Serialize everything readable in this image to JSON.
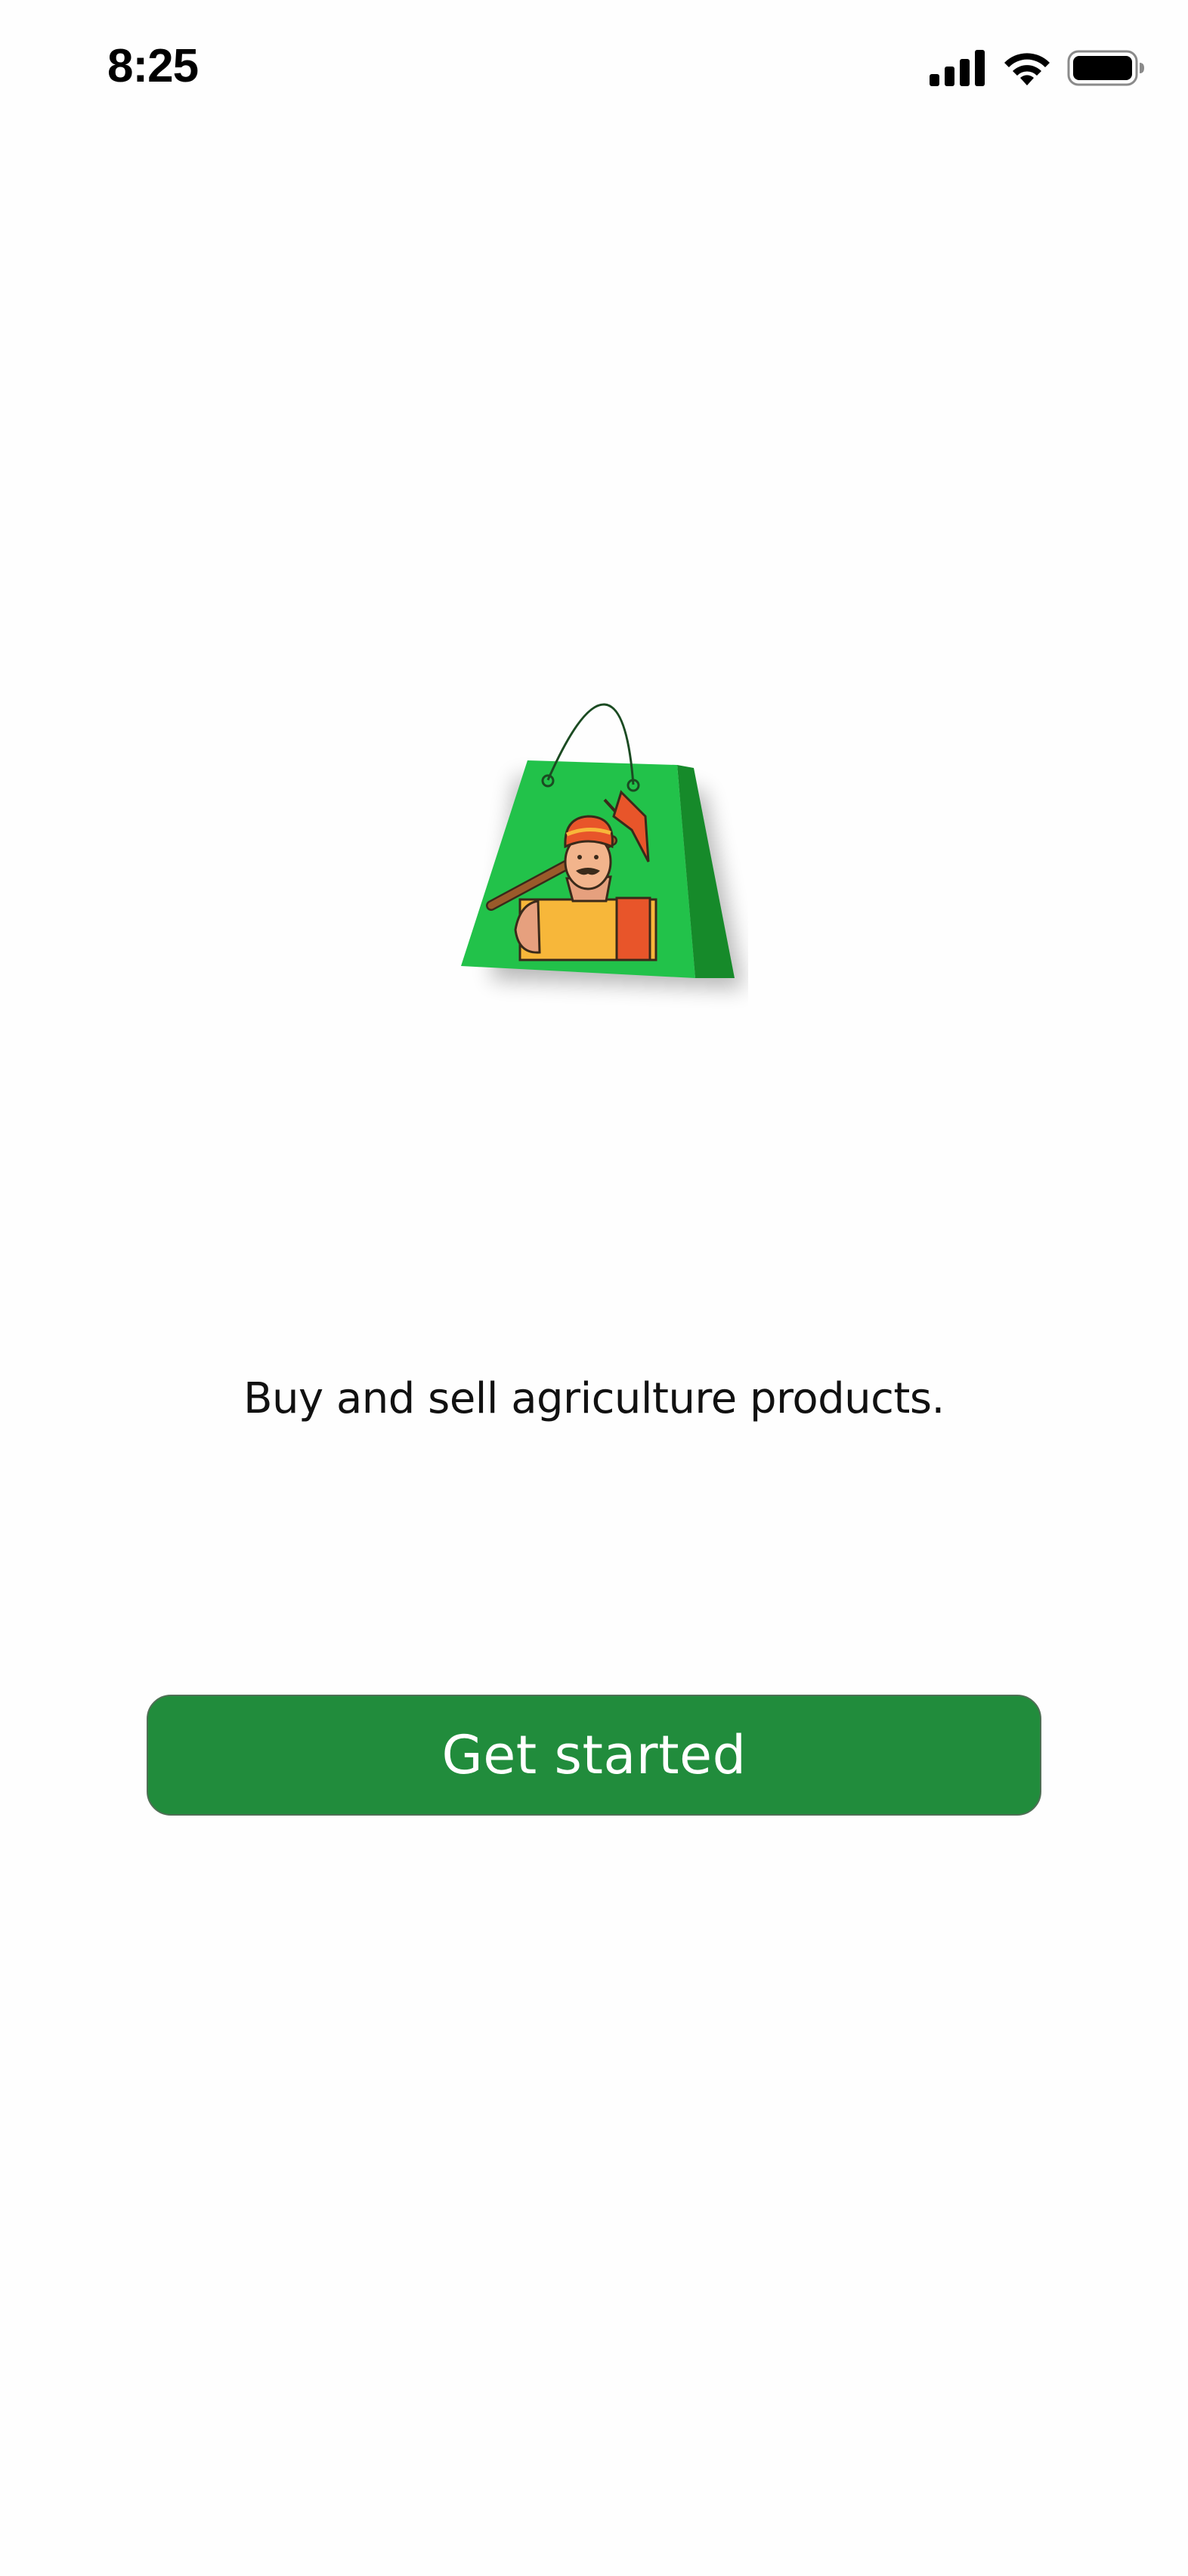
{
  "status_bar": {
    "time": "8:25",
    "signal_icon": "cellular-signal-icon",
    "wifi_icon": "wifi-icon",
    "battery_icon": "battery-icon"
  },
  "logo": {
    "icon": "farmer-shopping-bag-logo",
    "bag_color": "#22c24a",
    "bag_side_color": "#168a2a"
  },
  "onboarding": {
    "tagline": "Buy and sell agriculture products.",
    "cta_label": "Get started"
  },
  "colors": {
    "accent": "#218c3c",
    "background": "#fefefe",
    "text": "#111111"
  }
}
